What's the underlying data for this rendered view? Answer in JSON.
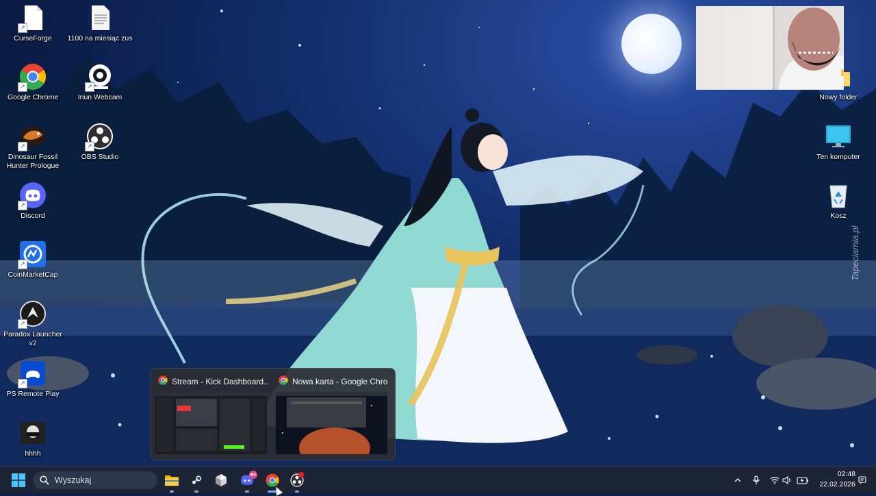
{
  "desktop": {
    "icons_left": [
      {
        "label": "CurseForge",
        "icon": "file-icon"
      },
      {
        "label": "Google Chrome",
        "icon": "chrome-icon"
      },
      {
        "label": "Dinosaur Fossil Hunter Prologue",
        "icon": "dinosaur-icon"
      },
      {
        "label": "Discord",
        "icon": "discord-icon"
      },
      {
        "label": "CoinMarketCap",
        "icon": "coinmarketcap-icon"
      },
      {
        "label": "Paradox Launcher v2",
        "icon": "paradox-icon"
      },
      {
        "label": "PS Remote Play",
        "icon": "gamepad-icon"
      },
      {
        "label": "hhhh",
        "icon": "photo-icon"
      }
    ],
    "icons_second_col": [
      {
        "label": "1100 na miesiąc zus",
        "icon": "text-file-icon"
      },
      {
        "label": "Iriun Webcam",
        "icon": "webcam-icon"
      },
      {
        "label": "OBS Studio",
        "icon": "obs-icon"
      }
    ],
    "icons_right": [
      {
        "label": "Nowy folder",
        "icon": "folder-icon"
      },
      {
        "label": "Ten komputer",
        "icon": "monitor-icon"
      },
      {
        "label": "Kosz",
        "icon": "recycle-bin-icon"
      }
    ],
    "watermark": "Tapeciarnia.pl"
  },
  "taskbar_preview": {
    "windows": [
      {
        "title": "Stream - Kick Dashboard...",
        "icon": "chrome-icon"
      },
      {
        "title": "Nowa karta - Google Chro...",
        "icon": "chrome-icon"
      }
    ]
  },
  "taskbar": {
    "search_placeholder": "Wyszukaj",
    "apps": [
      {
        "name": "File Explorer",
        "icon": "folder-icon"
      },
      {
        "name": "Steam",
        "icon": "steam-icon"
      },
      {
        "name": "Unity Hub",
        "icon": "unity-icon"
      },
      {
        "name": "Discord",
        "icon": "discord-icon",
        "badge": "9+"
      },
      {
        "name": "Google Chrome",
        "icon": "chrome-icon"
      },
      {
        "name": "OBS Studio",
        "icon": "obs-icon"
      }
    ],
    "clock": {
      "time": "02:48",
      "date": "22.02.2026"
    }
  },
  "colors": {
    "taskbar_bg": "#1c2436",
    "preview_bg": "#2d2d32",
    "discord_blurple": "#5865f2",
    "chrome_red": "#ea4335",
    "chrome_yellow": "#fbbc05",
    "chrome_green": "#34a853",
    "chrome_blue": "#4285f4"
  }
}
